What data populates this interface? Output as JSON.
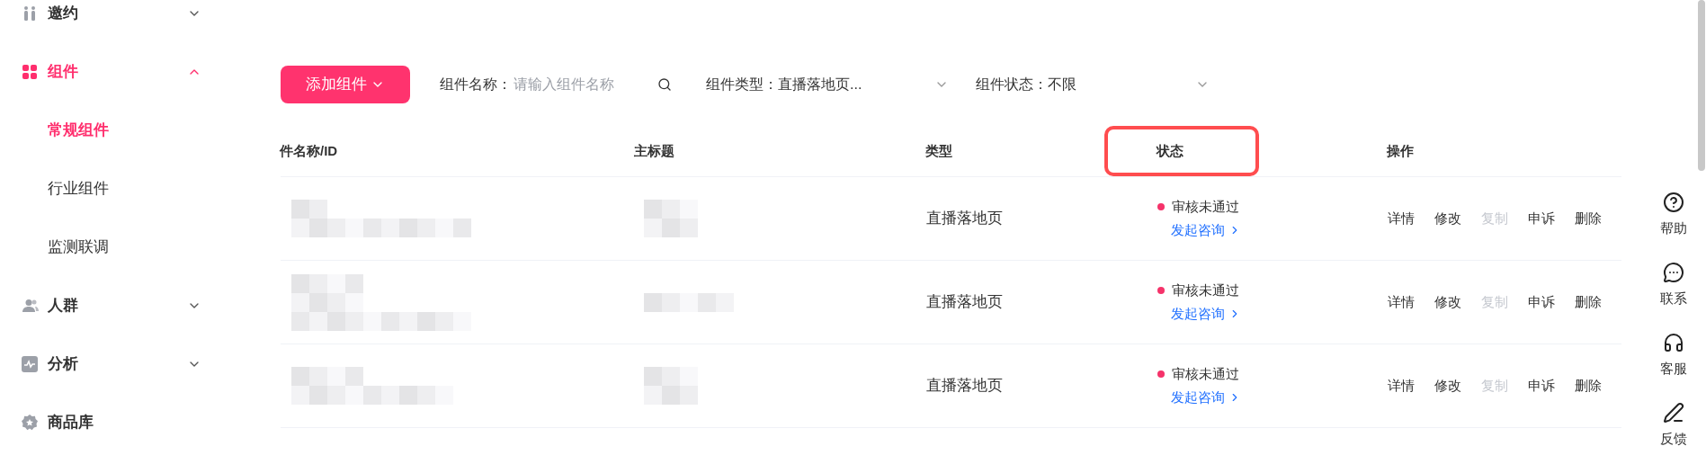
{
  "sidebar": {
    "items": [
      {
        "label": "邀约",
        "expanded": false,
        "selected": false
      },
      {
        "label": "组件",
        "expanded": true,
        "selected": true,
        "children": [
          {
            "label": "常规组件",
            "selected": true
          },
          {
            "label": "行业组件",
            "selected": false
          },
          {
            "label": "监测联调",
            "selected": false
          }
        ]
      },
      {
        "label": "人群",
        "expanded": false,
        "selected": false
      },
      {
        "label": "分析",
        "expanded": false,
        "selected": false
      },
      {
        "label": "商品库",
        "selected": false
      }
    ]
  },
  "toolbar": {
    "add_button": "添加组件",
    "name_filter": {
      "label": "组件名称：",
      "placeholder": "请输入组件名称"
    },
    "type_filter": {
      "label": "组件类型：",
      "value": "直播落地页..."
    },
    "status_filter": {
      "label": "组件状态：",
      "value": "不限"
    }
  },
  "table": {
    "columns": [
      {
        "label": "件名称/ID",
        "highlighted": false
      },
      {
        "label": "主标题",
        "highlighted": false
      },
      {
        "label": "类型",
        "highlighted": false
      },
      {
        "label": "状态",
        "highlighted": true
      },
      {
        "label": "操作",
        "highlighted": false
      }
    ],
    "rows": [
      {
        "kind": "redacted",
        "type": "直播落地页",
        "status": "审核未通过",
        "color": "#f5336a",
        "link": "发起咨询",
        "actions": [
          {
            "label": "详情",
            "disabled": false
          },
          {
            "label": "修改",
            "disabled": false
          },
          {
            "label": "复制",
            "disabled": true
          },
          {
            "label": "申诉",
            "disabled": false
          },
          {
            "label": "删除",
            "disabled": false
          }
        ]
      },
      {
        "kind": "redacted",
        "type": "直播落地页",
        "status": "审核未通过",
        "color": "#f5336a",
        "link": "发起咨询",
        "actions": [
          {
            "label": "详情",
            "disabled": false
          },
          {
            "label": "修改",
            "disabled": false
          },
          {
            "label": "复制",
            "disabled": true
          },
          {
            "label": "申诉",
            "disabled": false
          },
          {
            "label": "删除",
            "disabled": false
          }
        ]
      },
      {
        "kind": "redacted",
        "type": "直播落地页",
        "status": "审核未通过",
        "color": "#f5336a",
        "link": "发起咨询",
        "actions": [
          {
            "label": "详情",
            "disabled": false
          },
          {
            "label": "修改",
            "disabled": false
          },
          {
            "label": "复制",
            "disabled": true
          },
          {
            "label": "申诉",
            "disabled": false
          },
          {
            "label": "删除",
            "disabled": false
          }
        ]
      },
      {
        "kind": "partial"
      }
    ]
  },
  "float_bar": [
    {
      "label": "帮助"
    },
    {
      "label": "联系"
    },
    {
      "label": "客服"
    },
    {
      "label": "反馈"
    }
  ]
}
